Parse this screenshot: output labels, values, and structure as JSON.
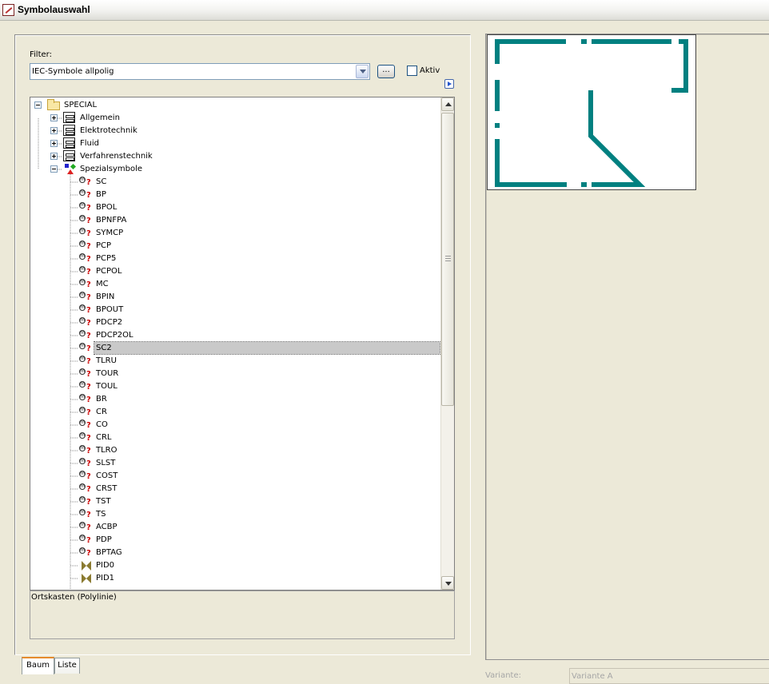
{
  "window": {
    "title": "Symbolauswahl",
    "icon": "app-symbol-icon"
  },
  "filter": {
    "label": "Filter:",
    "selected": "IEC-Symbole allpolig",
    "browse_label": "...",
    "aktiv_label": "Aktiv",
    "aktiv_checked": false
  },
  "tree": {
    "root": {
      "label": "SPECIAL",
      "icon": "folder-icon",
      "expanded": true
    },
    "groups": [
      {
        "label": "Allgemein",
        "icon": "cabinet-icon",
        "expanded": false
      },
      {
        "label": "Elektrotechnik",
        "icon": "cabinet-icon",
        "expanded": false
      },
      {
        "label": "Fluid",
        "icon": "cabinet-icon",
        "expanded": false
      },
      {
        "label": "Verfahrenstechnik",
        "icon": "cabinet-icon",
        "expanded": false
      },
      {
        "label": "Spezialsymbole",
        "icon": "special-symbols-icon",
        "expanded": true
      }
    ],
    "items": [
      {
        "label": "SC",
        "icon": "macro-symbol-icon"
      },
      {
        "label": "BP",
        "icon": "macro-symbol-icon"
      },
      {
        "label": "BPOL",
        "icon": "macro-symbol-icon"
      },
      {
        "label": "BPNFPA",
        "icon": "macro-symbol-icon"
      },
      {
        "label": "SYMCP",
        "icon": "macro-symbol-icon"
      },
      {
        "label": "PCP",
        "icon": "macro-symbol-icon"
      },
      {
        "label": "PCP5",
        "icon": "macro-symbol-icon"
      },
      {
        "label": "PCPOL",
        "icon": "macro-symbol-icon"
      },
      {
        "label": "MC",
        "icon": "macro-symbol-icon"
      },
      {
        "label": "BPIN",
        "icon": "macro-symbol-icon"
      },
      {
        "label": "BPOUT",
        "icon": "macro-symbol-icon"
      },
      {
        "label": "PDCP2",
        "icon": "macro-symbol-icon"
      },
      {
        "label": "PDCP2OL",
        "icon": "macro-symbol-icon"
      },
      {
        "label": "SC2",
        "icon": "macro-symbol-icon",
        "selected": true
      },
      {
        "label": "TLRU",
        "icon": "macro-symbol-icon"
      },
      {
        "label": "TOUR",
        "icon": "macro-symbol-icon"
      },
      {
        "label": "TOUL",
        "icon": "macro-symbol-icon"
      },
      {
        "label": "BR",
        "icon": "macro-symbol-icon"
      },
      {
        "label": "CR",
        "icon": "macro-symbol-icon"
      },
      {
        "label": "CO",
        "icon": "macro-symbol-icon"
      },
      {
        "label": "CRL",
        "icon": "macro-symbol-icon"
      },
      {
        "label": "TLRO",
        "icon": "macro-symbol-icon"
      },
      {
        "label": "SLST",
        "icon": "macro-symbol-icon"
      },
      {
        "label": "COST",
        "icon": "macro-symbol-icon"
      },
      {
        "label": "CRST",
        "icon": "macro-symbol-icon"
      },
      {
        "label": "TST",
        "icon": "macro-symbol-icon"
      },
      {
        "label": "TS",
        "icon": "macro-symbol-icon"
      },
      {
        "label": "ACBP",
        "icon": "macro-symbol-icon"
      },
      {
        "label": "PDP",
        "icon": "macro-symbol-icon"
      },
      {
        "label": "BPTAG",
        "icon": "macro-symbol-icon"
      },
      {
        "label": "PID0",
        "icon": "pid-symbol-icon"
      },
      {
        "label": "PID1",
        "icon": "pid-symbol-icon"
      }
    ]
  },
  "description": "Ortskasten (Polylinie)",
  "tabs": [
    {
      "label": "Baum",
      "active": true
    },
    {
      "label": "Liste",
      "active": false
    }
  ],
  "preview": {
    "symbol": "SC2",
    "stroke_color": "#008080"
  },
  "variant": {
    "label": "Variante:",
    "value": "Variante A",
    "enabled": false
  }
}
